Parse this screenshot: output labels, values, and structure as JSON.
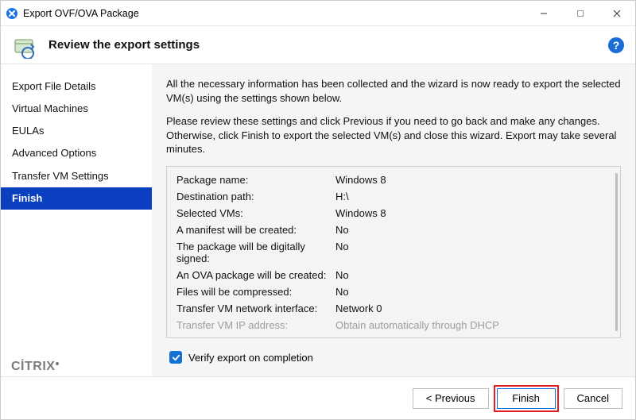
{
  "titlebar": {
    "title": "Export OVF/OVA Package"
  },
  "header": {
    "title": "Review the export settings"
  },
  "sidebar": {
    "items": [
      "Export File Details",
      "Virtual Machines",
      "EULAs",
      "Advanced Options",
      "Transfer VM Settings",
      "Finish"
    ],
    "selected_index": 5
  },
  "main": {
    "intro1": "All the necessary information has been collected and the wizard is now ready to export the selected VM(s) using the settings shown below.",
    "intro2": "Please review these settings and click Previous if you need to go back and make any changes. Otherwise, click Finish to export the selected VM(s) and close this wizard. Export may take several minutes.",
    "settings": [
      {
        "k": "Package name:",
        "v": "Windows 8"
      },
      {
        "k": "Destination path:",
        "v": "H:\\"
      },
      {
        "k": "Selected VMs:",
        "v": "Windows 8"
      },
      {
        "k": "A manifest will be created:",
        "v": "No"
      },
      {
        "k": "The package will be digitally signed:",
        "v": "No"
      },
      {
        "k": "An OVA package will be created:",
        "v": "No"
      },
      {
        "k": "Files will be compressed:",
        "v": "No"
      },
      {
        "k": "Transfer VM network interface:",
        "v": "Network 0"
      }
    ],
    "cutoff_k": "Transfer VM IP address:",
    "cutoff_v": "Obtain automatically through DHCP",
    "verify_label": "Verify export on completion",
    "verify_checked": true
  },
  "footer": {
    "previous": "< Previous",
    "finish": "Finish",
    "cancel": "Cancel"
  },
  "brand": "CİTRIX"
}
